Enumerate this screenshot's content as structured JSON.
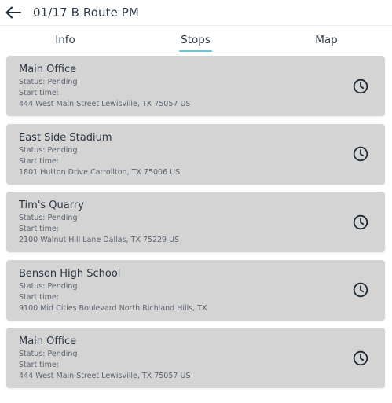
{
  "header": {
    "back_icon": "arrow-left-icon",
    "title": "01/17 B Route PM"
  },
  "tabs": [
    {
      "label": "Info",
      "active": false
    },
    {
      "label": "Stops",
      "active": true
    },
    {
      "label": "Map",
      "active": false
    }
  ],
  "colors": {
    "accent": "#6cc3d6",
    "card_bg": "#d4d4d4",
    "text": "#2a3440"
  },
  "stops": [
    {
      "name": "Main Office",
      "status": "Status: Pending",
      "start_time": "Start time:",
      "address": "444 West Main Street Lewisville, TX 75057 US",
      "icon": "clock-icon"
    },
    {
      "name": "East Side Stadium",
      "status": "Status: Pending",
      "start_time": "Start time:",
      "address": "1801 Hutton Drive Carrollton, TX 75006 US",
      "icon": "clock-icon"
    },
    {
      "name": "Tim's Quarry",
      "status": "Status: Pending",
      "start_time": "Start time:",
      "address": "2100 Walnut Hill Lane Dallas, TX 75229 US",
      "icon": "clock-icon"
    },
    {
      "name": "Benson High School",
      "status": "Status: Pending",
      "start_time": "Start time:",
      "address": "9100 Mid Cities Boulevard North Richland Hills, TX",
      "icon": "clock-icon"
    },
    {
      "name": "Main Office",
      "status": "Status: Pending",
      "start_time": "Start time:",
      "address": "444 West Main Street Lewisville, TX 75057 US",
      "icon": "clock-icon"
    }
  ]
}
